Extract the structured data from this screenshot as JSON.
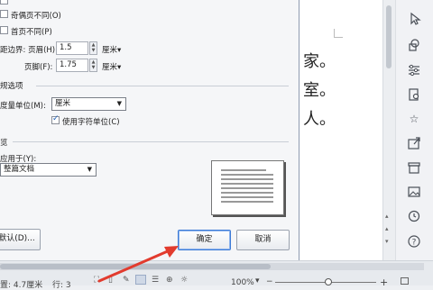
{
  "dialog": {
    "odd_even_label": "奇偶页不同(O)",
    "first_page_label": "首页不同(P)",
    "header_label": "距边界: 页眉(H):",
    "header_value": "1.5",
    "header_unit": "厘米▾",
    "footer_label": "页脚(F):",
    "footer_value": "1.75",
    "footer_unit": "厘米▾",
    "section_general": "规选项",
    "measure_label": "度量单位(M):",
    "measure_value": "厘米",
    "char_unit_label": "使用字符单位(C)",
    "section_preview": "览",
    "apply_label": "应用于(Y):",
    "apply_value": "整篇文档",
    "default_button": "默认(D)...",
    "ok_button": "确定",
    "cancel_button": "取消"
  },
  "document": {
    "line1": "家。",
    "line2": "室。",
    "line3": "人。"
  },
  "statusbar": {
    "position_text": "置: 4.7厘米",
    "line_text": "行: 3",
    "zoom_text": "100%",
    "zoom_minus": "−",
    "zoom_plus": "+"
  },
  "colors": {
    "annotation_arrow": "#e23b2e",
    "accent": "#3d7bd6"
  }
}
